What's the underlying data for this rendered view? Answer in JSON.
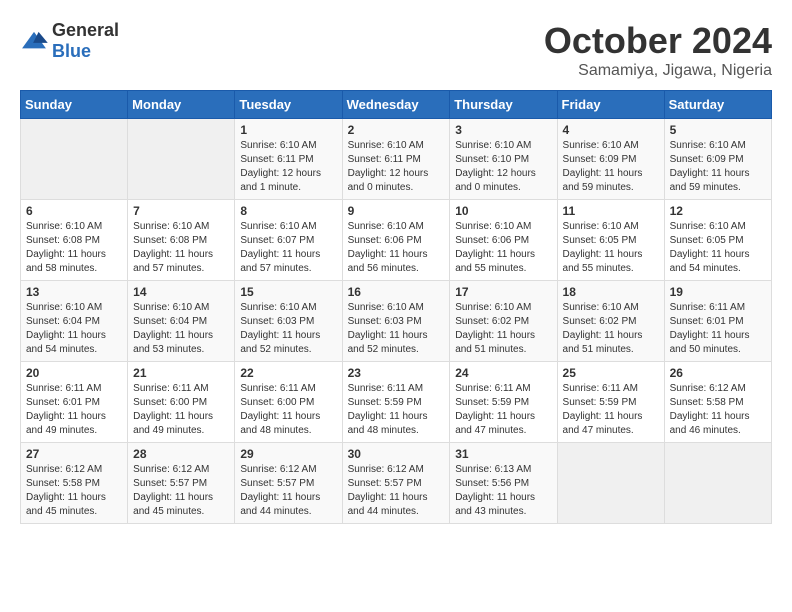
{
  "logo": {
    "general": "General",
    "blue": "Blue"
  },
  "title": "October 2024",
  "location": "Samamiya, Jigawa, Nigeria",
  "days_of_week": [
    "Sunday",
    "Monday",
    "Tuesday",
    "Wednesday",
    "Thursday",
    "Friday",
    "Saturday"
  ],
  "weeks": [
    [
      {
        "day": "",
        "sunrise": "",
        "sunset": "",
        "daylight": ""
      },
      {
        "day": "",
        "sunrise": "",
        "sunset": "",
        "daylight": ""
      },
      {
        "day": "1",
        "sunrise": "Sunrise: 6:10 AM",
        "sunset": "Sunset: 6:11 PM",
        "daylight": "Daylight: 12 hours and 1 minute."
      },
      {
        "day": "2",
        "sunrise": "Sunrise: 6:10 AM",
        "sunset": "Sunset: 6:11 PM",
        "daylight": "Daylight: 12 hours and 0 minutes."
      },
      {
        "day": "3",
        "sunrise": "Sunrise: 6:10 AM",
        "sunset": "Sunset: 6:10 PM",
        "daylight": "Daylight: 12 hours and 0 minutes."
      },
      {
        "day": "4",
        "sunrise": "Sunrise: 6:10 AM",
        "sunset": "Sunset: 6:09 PM",
        "daylight": "Daylight: 11 hours and 59 minutes."
      },
      {
        "day": "5",
        "sunrise": "Sunrise: 6:10 AM",
        "sunset": "Sunset: 6:09 PM",
        "daylight": "Daylight: 11 hours and 59 minutes."
      }
    ],
    [
      {
        "day": "6",
        "sunrise": "Sunrise: 6:10 AM",
        "sunset": "Sunset: 6:08 PM",
        "daylight": "Daylight: 11 hours and 58 minutes."
      },
      {
        "day": "7",
        "sunrise": "Sunrise: 6:10 AM",
        "sunset": "Sunset: 6:08 PM",
        "daylight": "Daylight: 11 hours and 57 minutes."
      },
      {
        "day": "8",
        "sunrise": "Sunrise: 6:10 AM",
        "sunset": "Sunset: 6:07 PM",
        "daylight": "Daylight: 11 hours and 57 minutes."
      },
      {
        "day": "9",
        "sunrise": "Sunrise: 6:10 AM",
        "sunset": "Sunset: 6:06 PM",
        "daylight": "Daylight: 11 hours and 56 minutes."
      },
      {
        "day": "10",
        "sunrise": "Sunrise: 6:10 AM",
        "sunset": "Sunset: 6:06 PM",
        "daylight": "Daylight: 11 hours and 55 minutes."
      },
      {
        "day": "11",
        "sunrise": "Sunrise: 6:10 AM",
        "sunset": "Sunset: 6:05 PM",
        "daylight": "Daylight: 11 hours and 55 minutes."
      },
      {
        "day": "12",
        "sunrise": "Sunrise: 6:10 AM",
        "sunset": "Sunset: 6:05 PM",
        "daylight": "Daylight: 11 hours and 54 minutes."
      }
    ],
    [
      {
        "day": "13",
        "sunrise": "Sunrise: 6:10 AM",
        "sunset": "Sunset: 6:04 PM",
        "daylight": "Daylight: 11 hours and 54 minutes."
      },
      {
        "day": "14",
        "sunrise": "Sunrise: 6:10 AM",
        "sunset": "Sunset: 6:04 PM",
        "daylight": "Daylight: 11 hours and 53 minutes."
      },
      {
        "day": "15",
        "sunrise": "Sunrise: 6:10 AM",
        "sunset": "Sunset: 6:03 PM",
        "daylight": "Daylight: 11 hours and 52 minutes."
      },
      {
        "day": "16",
        "sunrise": "Sunrise: 6:10 AM",
        "sunset": "Sunset: 6:03 PM",
        "daylight": "Daylight: 11 hours and 52 minutes."
      },
      {
        "day": "17",
        "sunrise": "Sunrise: 6:10 AM",
        "sunset": "Sunset: 6:02 PM",
        "daylight": "Daylight: 11 hours and 51 minutes."
      },
      {
        "day": "18",
        "sunrise": "Sunrise: 6:10 AM",
        "sunset": "Sunset: 6:02 PM",
        "daylight": "Daylight: 11 hours and 51 minutes."
      },
      {
        "day": "19",
        "sunrise": "Sunrise: 6:11 AM",
        "sunset": "Sunset: 6:01 PM",
        "daylight": "Daylight: 11 hours and 50 minutes."
      }
    ],
    [
      {
        "day": "20",
        "sunrise": "Sunrise: 6:11 AM",
        "sunset": "Sunset: 6:01 PM",
        "daylight": "Daylight: 11 hours and 49 minutes."
      },
      {
        "day": "21",
        "sunrise": "Sunrise: 6:11 AM",
        "sunset": "Sunset: 6:00 PM",
        "daylight": "Daylight: 11 hours and 49 minutes."
      },
      {
        "day": "22",
        "sunrise": "Sunrise: 6:11 AM",
        "sunset": "Sunset: 6:00 PM",
        "daylight": "Daylight: 11 hours and 48 minutes."
      },
      {
        "day": "23",
        "sunrise": "Sunrise: 6:11 AM",
        "sunset": "Sunset: 5:59 PM",
        "daylight": "Daylight: 11 hours and 48 minutes."
      },
      {
        "day": "24",
        "sunrise": "Sunrise: 6:11 AM",
        "sunset": "Sunset: 5:59 PM",
        "daylight": "Daylight: 11 hours and 47 minutes."
      },
      {
        "day": "25",
        "sunrise": "Sunrise: 6:11 AM",
        "sunset": "Sunset: 5:59 PM",
        "daylight": "Daylight: 11 hours and 47 minutes."
      },
      {
        "day": "26",
        "sunrise": "Sunrise: 6:12 AM",
        "sunset": "Sunset: 5:58 PM",
        "daylight": "Daylight: 11 hours and 46 minutes."
      }
    ],
    [
      {
        "day": "27",
        "sunrise": "Sunrise: 6:12 AM",
        "sunset": "Sunset: 5:58 PM",
        "daylight": "Daylight: 11 hours and 45 minutes."
      },
      {
        "day": "28",
        "sunrise": "Sunrise: 6:12 AM",
        "sunset": "Sunset: 5:57 PM",
        "daylight": "Daylight: 11 hours and 45 minutes."
      },
      {
        "day": "29",
        "sunrise": "Sunrise: 6:12 AM",
        "sunset": "Sunset: 5:57 PM",
        "daylight": "Daylight: 11 hours and 44 minutes."
      },
      {
        "day": "30",
        "sunrise": "Sunrise: 6:12 AM",
        "sunset": "Sunset: 5:57 PM",
        "daylight": "Daylight: 11 hours and 44 minutes."
      },
      {
        "day": "31",
        "sunrise": "Sunrise: 6:13 AM",
        "sunset": "Sunset: 5:56 PM",
        "daylight": "Daylight: 11 hours and 43 minutes."
      },
      {
        "day": "",
        "sunrise": "",
        "sunset": "",
        "daylight": ""
      },
      {
        "day": "",
        "sunrise": "",
        "sunset": "",
        "daylight": ""
      }
    ]
  ]
}
